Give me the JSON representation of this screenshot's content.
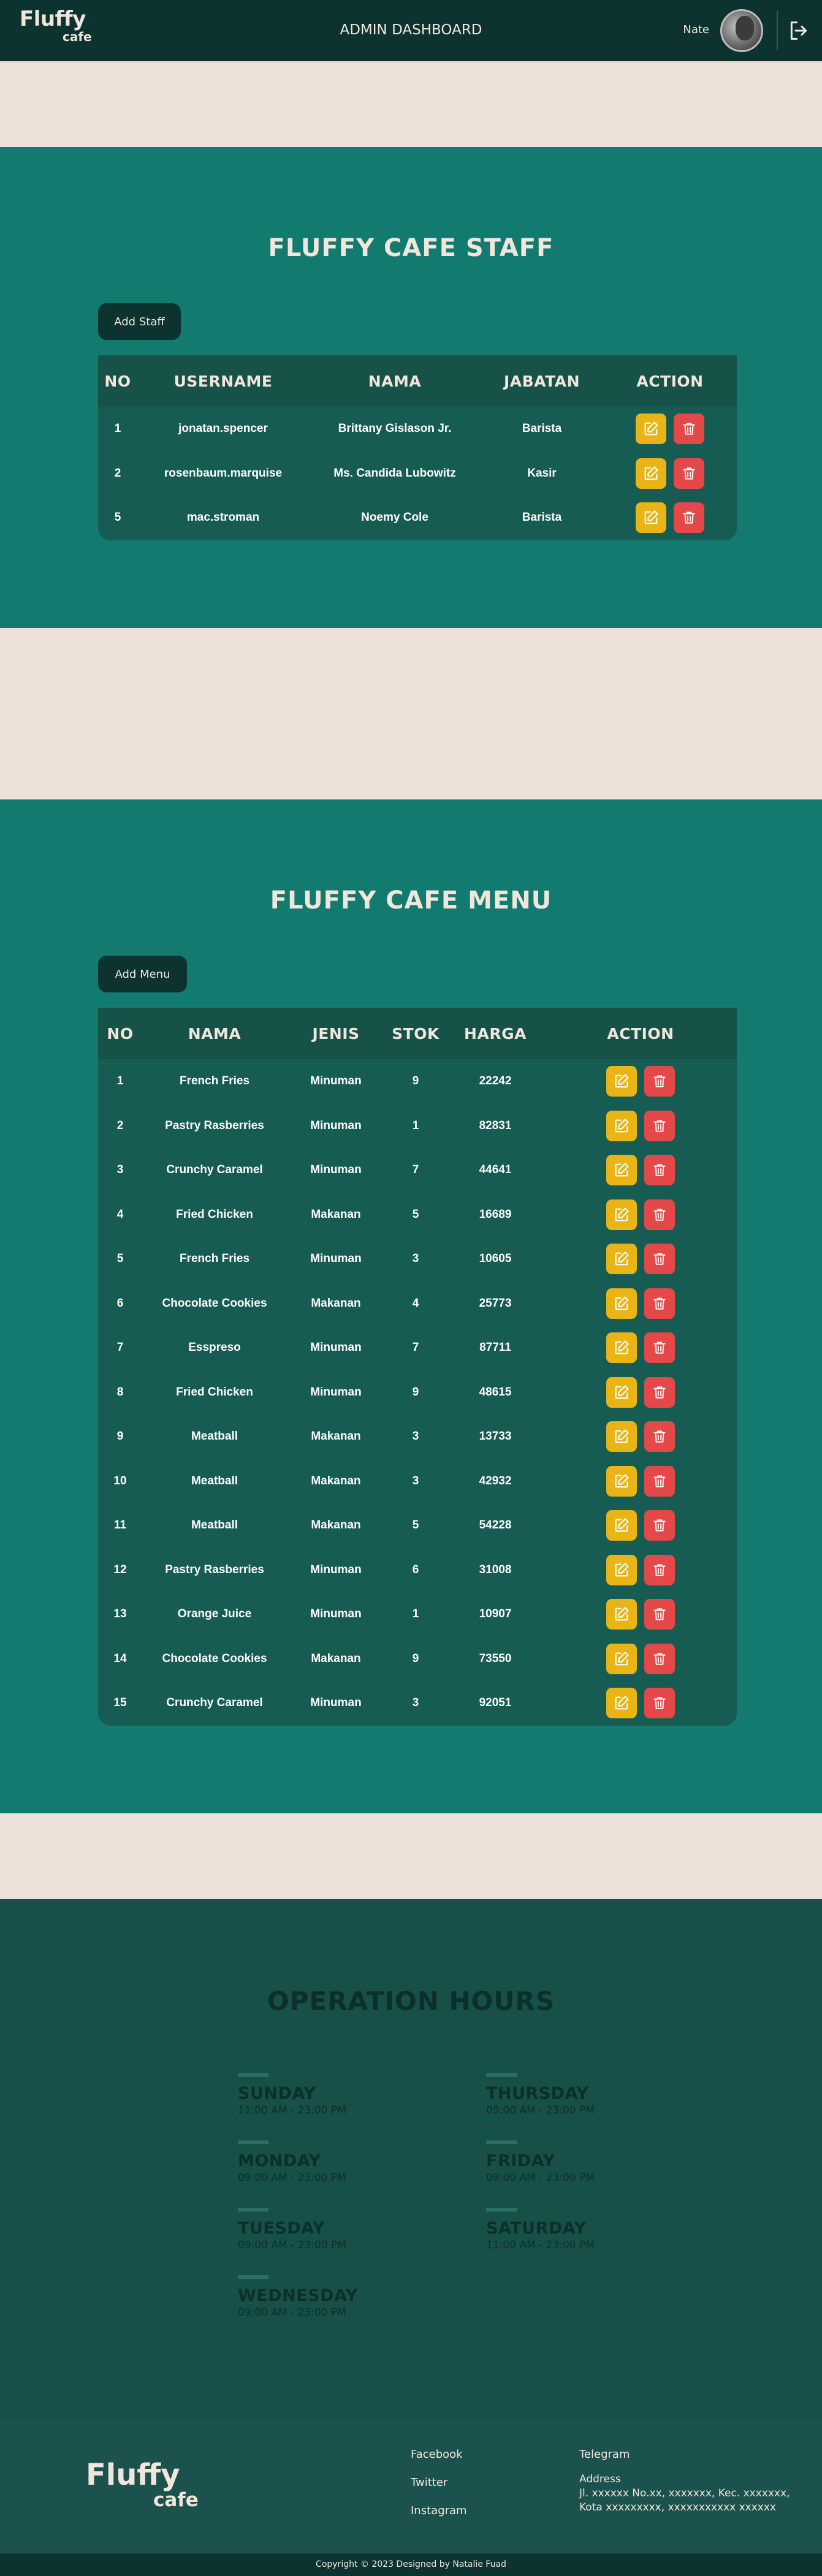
{
  "header": {
    "logo_line1": "Fluffy",
    "logo_line2": "cafe",
    "title": "ADMIN DASHBOARD",
    "user_name": "Nate"
  },
  "staff": {
    "title": "FLUFFY CAFE STAFF",
    "add_label": "Add Staff",
    "columns": [
      "NO",
      "USERNAME",
      "NAMA",
      "JABATAN",
      "ACTION"
    ],
    "rows": [
      {
        "no": "1",
        "username": "jonatan.spencer",
        "nama": "Brittany Gislason Jr.",
        "jabatan": "Barista"
      },
      {
        "no": "2",
        "username": "rosenbaum.marquise",
        "nama": "Ms. Candida Lubowitz",
        "jabatan": "Kasir"
      },
      {
        "no": "5",
        "username": "mac.stroman",
        "nama": "Noemy Cole",
        "jabatan": "Barista"
      }
    ]
  },
  "menu": {
    "title": "FLUFFY CAFE MENU",
    "add_label": "Add Menu",
    "columns": [
      "NO",
      "NAMA",
      "JENIS",
      "STOK",
      "HARGA",
      "ACTION"
    ],
    "rows": [
      {
        "no": "1",
        "nama": "French Fries",
        "jenis": "Minuman",
        "stok": "9",
        "harga": "22242"
      },
      {
        "no": "2",
        "nama": "Pastry Rasberries",
        "jenis": "Minuman",
        "stok": "1",
        "harga": "82831"
      },
      {
        "no": "3",
        "nama": "Crunchy Caramel",
        "jenis": "Minuman",
        "stok": "7",
        "harga": "44641"
      },
      {
        "no": "4",
        "nama": "Fried Chicken",
        "jenis": "Makanan",
        "stok": "5",
        "harga": "16689"
      },
      {
        "no": "5",
        "nama": "French Fries",
        "jenis": "Minuman",
        "stok": "3",
        "harga": "10605"
      },
      {
        "no": "6",
        "nama": "Chocolate Cookies",
        "jenis": "Makanan",
        "stok": "4",
        "harga": "25773"
      },
      {
        "no": "7",
        "nama": "Esspreso",
        "jenis": "Minuman",
        "stok": "7",
        "harga": "87711"
      },
      {
        "no": "8",
        "nama": "Fried Chicken",
        "jenis": "Minuman",
        "stok": "9",
        "harga": "48615"
      },
      {
        "no": "9",
        "nama": "Meatball",
        "jenis": "Makanan",
        "stok": "3",
        "harga": "13733"
      },
      {
        "no": "10",
        "nama": "Meatball",
        "jenis": "Makanan",
        "stok": "3",
        "harga": "42932"
      },
      {
        "no": "11",
        "nama": "Meatball",
        "jenis": "Makanan",
        "stok": "5",
        "harga": "54228"
      },
      {
        "no": "12",
        "nama": "Pastry Rasberries",
        "jenis": "Minuman",
        "stok": "6",
        "harga": "31008"
      },
      {
        "no": "13",
        "nama": "Orange Juice",
        "jenis": "Minuman",
        "stok": "1",
        "harga": "10907"
      },
      {
        "no": "14",
        "nama": "Chocolate Cookies",
        "jenis": "Makanan",
        "stok": "9",
        "harga": "73550"
      },
      {
        "no": "15",
        "nama": "Crunchy Caramel",
        "jenis": "Minuman",
        "stok": "3",
        "harga": "92051"
      }
    ]
  },
  "hours": {
    "title": "OPERATION HOURS",
    "days": [
      {
        "name": "SUNDAY",
        "time": "11:00 AM - 23:00 PM"
      },
      {
        "name": "MONDAY",
        "time": "09:00 AM - 23:00 PM"
      },
      {
        "name": "TUESDAY",
        "time": "09:00 AM - 23:00 PM"
      },
      {
        "name": "WEDNESDAY",
        "time": "09:00 AM - 23:00 PM"
      },
      {
        "name": "THURSDAY",
        "time": "09:00 AM - 23:00 PM"
      },
      {
        "name": "FRIDAY",
        "time": "09:00 AM - 23:00 PM"
      },
      {
        "name": "SATURDAY",
        "time": "11:00 AM - 23:00 PM"
      }
    ]
  },
  "footer": {
    "logo_line1": "Fluffy",
    "logo_line2": "cafe",
    "facebook": "Facebook",
    "twitter": "Twitter",
    "instagram": "Instagram",
    "telegram": "Telegram",
    "address_label": "Address",
    "address_line1": "Jl. xxxxxx No.xx, xxxxxxx, Kec. xxxxxxx,",
    "address_line2": "Kota xxxxxxxxx, xxxxxxxxxxx xxxxxx",
    "copyright": "Copyright © 2023 Designed by Natalie Fuad"
  },
  "colors": {
    "header_bg": "#0c3330",
    "section_teal": "#137a6f",
    "edit_button": "#e8b416",
    "delete_button": "#e54848",
    "cream": "#ece2da"
  }
}
